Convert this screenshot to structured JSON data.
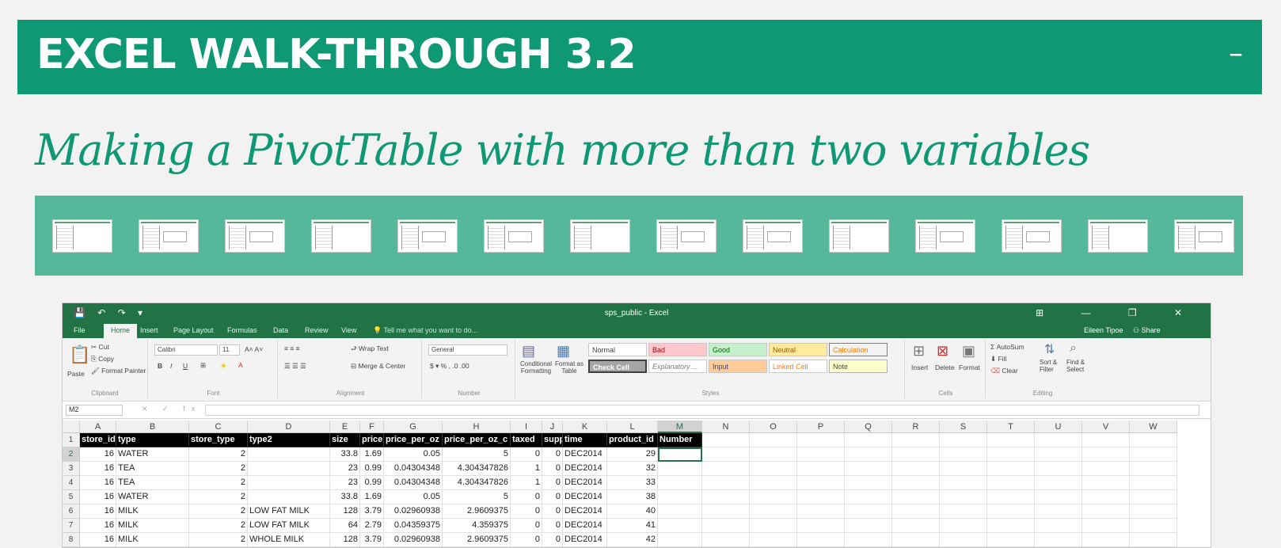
{
  "banner": {
    "title": "EXCEL WALK-THROUGH 3.2",
    "minimize": "–"
  },
  "subtitle": "Making a PivotTable with more than two variables",
  "thumbnails": {
    "count": 14
  },
  "excel": {
    "window_title": "sps_public - Excel",
    "quick_access": "💾 ↶ ↷ ▾",
    "window_controls": "⊞ — ❐ ✕",
    "tabs": [
      "File",
      "Home",
      "Insert",
      "Page Layout",
      "Formulas",
      "Data",
      "Review",
      "View"
    ],
    "tell_me": "💡 Tell me what you want to do...",
    "user": "Eileen Tipoe",
    "share": "Share",
    "ribbon": {
      "clipboard": {
        "paste": "Paste",
        "cut": "Cut",
        "copy": "Copy",
        "format_painter": "Format Painter",
        "label": "Clipboard"
      },
      "font": {
        "name": "Calibri",
        "size": "11",
        "label": "Font",
        "bold": "B",
        "italic": "I",
        "underline": "U"
      },
      "alignment": {
        "wrap": "Wrap Text",
        "merge": "Merge & Center",
        "label": "Alignment"
      },
      "number": {
        "format": "General",
        "label": "Number"
      },
      "styles": {
        "conditional": "Conditional Formatting",
        "format_table": "Format as Table",
        "label": "Styles",
        "normal": "Normal",
        "bad": "Bad",
        "good": "Good",
        "neutral": "Neutral",
        "calculation": "Calculation",
        "check_cell": "Check Cell",
        "explanatory": "Explanatory ...",
        "input": "Input",
        "linked_cell": "Linked Cell",
        "note": "Note"
      },
      "cells": {
        "insert": "Insert",
        "delete": "Delete",
        "format": "Format",
        "label": "Cells"
      },
      "editing": {
        "autosum": "AutoSum",
        "fill": "Fill",
        "clear": "Clear",
        "sort": "Sort & Filter",
        "find": "Find & Select",
        "label": "Editing"
      }
    },
    "name_box": "M2",
    "fx": "✕ ✓ fx",
    "columns": [
      "A",
      "B",
      "C",
      "D",
      "E",
      "F",
      "G",
      "H",
      "I",
      "J",
      "K",
      "L",
      "M",
      "N",
      "O",
      "P",
      "Q",
      "R",
      "S",
      "T",
      "U",
      "V",
      "W"
    ],
    "selected_column": "M",
    "selected_row": "2",
    "rows": [
      {
        "n": "1",
        "cells": [
          "store_id",
          "type",
          "store_type",
          "type2",
          "size",
          "price",
          "price_per_oz",
          "price_per_oz_c",
          "taxed",
          "supp",
          "time",
          "product_id",
          "Number"
        ]
      },
      {
        "n": "2",
        "cells": [
          "16",
          "WATER",
          "2",
          "",
          "33.8",
          "1.69",
          "0.05",
          "5",
          "0",
          "0",
          "DEC2014",
          "29",
          ""
        ]
      },
      {
        "n": "3",
        "cells": [
          "16",
          "TEA",
          "2",
          "",
          "23",
          "0.99",
          "0.04304348",
          "4.304347826",
          "1",
          "0",
          "DEC2014",
          "32",
          ""
        ]
      },
      {
        "n": "4",
        "cells": [
          "16",
          "TEA",
          "2",
          "",
          "23",
          "0.99",
          "0.04304348",
          "4.304347826",
          "1",
          "0",
          "DEC2014",
          "33",
          ""
        ]
      },
      {
        "n": "5",
        "cells": [
          "16",
          "WATER",
          "2",
          "",
          "33.8",
          "1.69",
          "0.05",
          "5",
          "0",
          "0",
          "DEC2014",
          "38",
          ""
        ]
      },
      {
        "n": "6",
        "cells": [
          "16",
          "MILK",
          "2",
          "LOW FAT MILK",
          "128",
          "3.79",
          "0.02960938",
          "2.9609375",
          "0",
          "0",
          "DEC2014",
          "40",
          ""
        ]
      },
      {
        "n": "7",
        "cells": [
          "16",
          "MILK",
          "2",
          "LOW FAT MILK",
          "64",
          "2.79",
          "0.04359375",
          "4.359375",
          "0",
          "0",
          "DEC2014",
          "41",
          ""
        ]
      },
      {
        "n": "8",
        "cells": [
          "16",
          "MILK",
          "2",
          "WHOLE MILK",
          "128",
          "3.79",
          "0.02960938",
          "2.9609375",
          "0",
          "0",
          "DEC2014",
          "42",
          ""
        ]
      }
    ]
  }
}
